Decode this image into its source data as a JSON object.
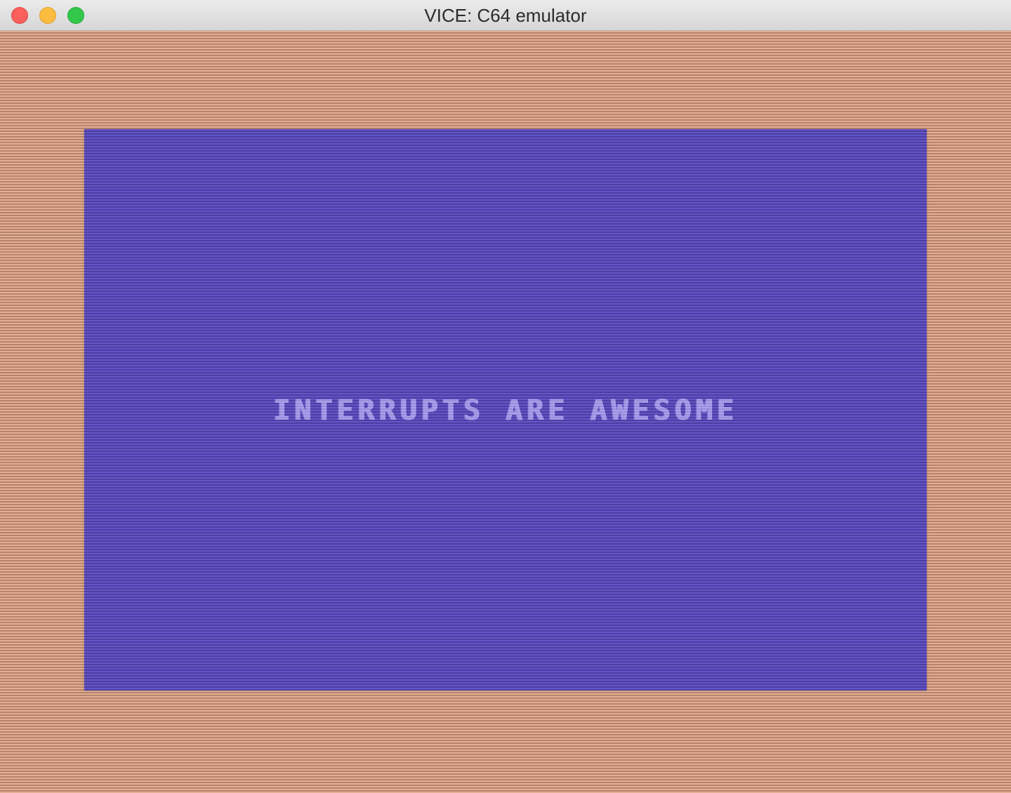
{
  "window": {
    "title": "VICE: C64 emulator"
  },
  "emulator": {
    "screen_text": "INTERRUPTS ARE AWESOME",
    "border_color": "#d9a388",
    "screen_color": "#5b4fc0",
    "text_color": "#a99ff0"
  },
  "icons": {
    "close": "close-icon",
    "minimize": "minimize-icon",
    "zoom": "zoom-icon"
  }
}
